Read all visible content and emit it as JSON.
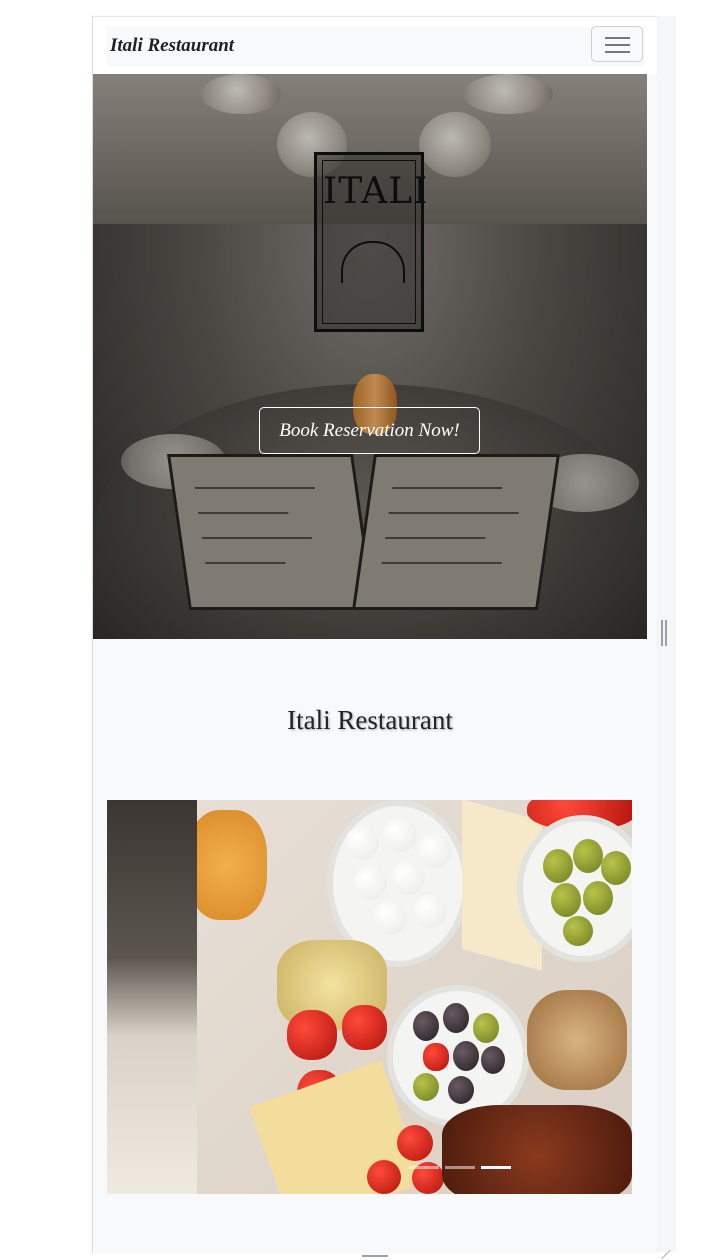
{
  "navbar": {
    "brand": "Itali Restaurant",
    "toggler_icon": "hamburger-menu-icon"
  },
  "hero": {
    "logo_text": "ITALI",
    "cta_label": "Book Reservation Now!"
  },
  "about": {
    "title": "Itali Restaurant"
  },
  "carousel": {
    "indicator_count": 3,
    "active_indicator": 3
  },
  "colors": {
    "page_bg": "#f8f9fa",
    "text": "#212529",
    "button_border": "#ffffff"
  }
}
